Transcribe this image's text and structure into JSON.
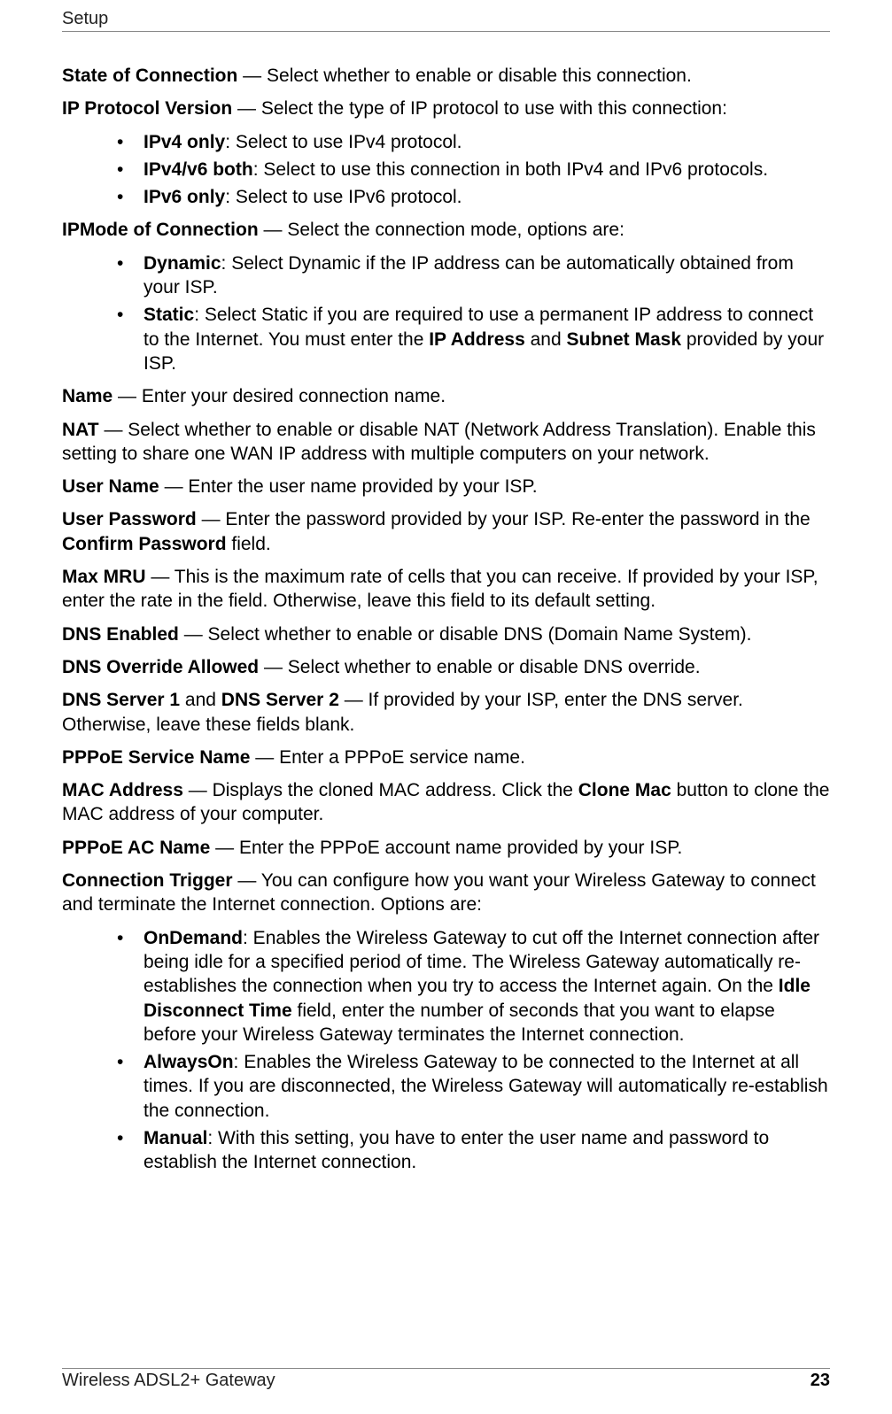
{
  "header": {
    "section": "Setup"
  },
  "footer": {
    "product": "Wireless ADSL2+ Gateway",
    "page_number": "23"
  },
  "terms": {
    "state_of_connection": "State of Connection",
    "ip_protocol_version": "IP Protocol Version",
    "ipv4_only": "IPv4 only",
    "ipv4v6_both": "IPv4/v6 both",
    "ipv6_only": "IPv6 only",
    "ipmode_of_connection": "IPMode of Connection",
    "dynamic": "Dynamic",
    "static": "Static",
    "ip_address": "IP Address",
    "subnet_mask": "Subnet Mask",
    "name": "Name",
    "nat": "NAT",
    "user_name": "User Name",
    "user_password": "User Password",
    "confirm_password": "Confirm Password",
    "max_mru": "Max MRU",
    "dns_enabled": "DNS Enabled",
    "dns_override_allowed": "DNS Override Allowed",
    "dns_server_1": "DNS Server 1",
    "dns_server_2": "DNS Server 2",
    "pppoe_service_name": "PPPoE Service Name",
    "mac_address": "MAC Address",
    "clone_mac": "Clone Mac",
    "pppoe_ac_name": "PPPoE AC Name",
    "connection_trigger": "Connection Trigger",
    "ondemand": "OnDemand",
    "idle_disconnect_time": "Idle Disconnect Time",
    "alwayson": "AlwaysOn",
    "manual": "Manual"
  },
  "text": {
    "soc_desc": " — Select whether to enable or disable this connection.",
    "ipv_desc": " — Select the type of IP protocol to use with this connection:",
    "ipv4_only_desc": ": Select to use IPv4 protocol.",
    "ipv4v6_both_desc": ": Select to use this connection in both IPv4 and IPv6 protocols.",
    "ipv6_only_desc": ": Select to use IPv6 protocol.",
    "ipmode_desc": " — Select the connection mode, options are:",
    "dynamic_desc": ": Select Dynamic if the IP address can be automatically obtained from your ISP.",
    "static_desc_a": ": Select Static if you are required to use a permanent IP address to connect to the Internet. You must enter the ",
    "static_desc_b": " and ",
    "static_desc_c": " provided by your ISP.",
    "name_desc": " — Enter your desired connection name.",
    "nat_desc": " — Select whether to enable or disable NAT (Network Address Translation). Enable this setting to share one WAN IP address with multiple computers on your network.",
    "user_name_desc": " — Enter the user name provided by your ISP.",
    "user_password_desc_a": " — Enter the password provided by your ISP. Re-enter the password in the ",
    "user_password_desc_b": " field.",
    "max_mru_desc": " — This is the maximum rate of cells that you can receive. If provided by your ISP, enter the rate in the field. Otherwise, leave this field to its default setting.",
    "dns_enabled_desc": " — Select whether to enable or disable DNS (Domain Name System).",
    "dns_override_desc": " — Select whether to enable or disable DNS override.",
    "dns_servers_mid": " and ",
    "dns_servers_desc": " — If provided by your ISP, enter the DNS server. Otherwise, leave these fields blank.",
    "pppoe_service_desc": " — Enter a PPPoE service name.",
    "mac_desc_a": " — Displays the cloned MAC address. Click the ",
    "mac_desc_b": " button to clone the MAC address of your computer.",
    "pppoe_ac_desc": " — Enter the PPPoE account name provided by your ISP.",
    "conn_trigger_desc": " — You can configure how you want your Wireless Gateway to connect and terminate the Internet connection. Options are:",
    "ondemand_desc_a": ": Enables the Wireless Gateway to cut off the Internet connection after being idle for a specified period of time. The Wireless Gateway automatically re-establishes the connection when you try to access the Internet again. On the ",
    "ondemand_desc_b": " field, enter the number of seconds that you want to elapse before your Wireless Gateway terminates the Internet connection.",
    "alwayson_desc": ": Enables the Wireless Gateway to be connected to the Internet at all times. If you are disconnected, the Wireless Gateway will automatically re-establish the connection.",
    "manual_desc": ": With this setting, you have to enter the user name and password to establish the Internet connection."
  }
}
